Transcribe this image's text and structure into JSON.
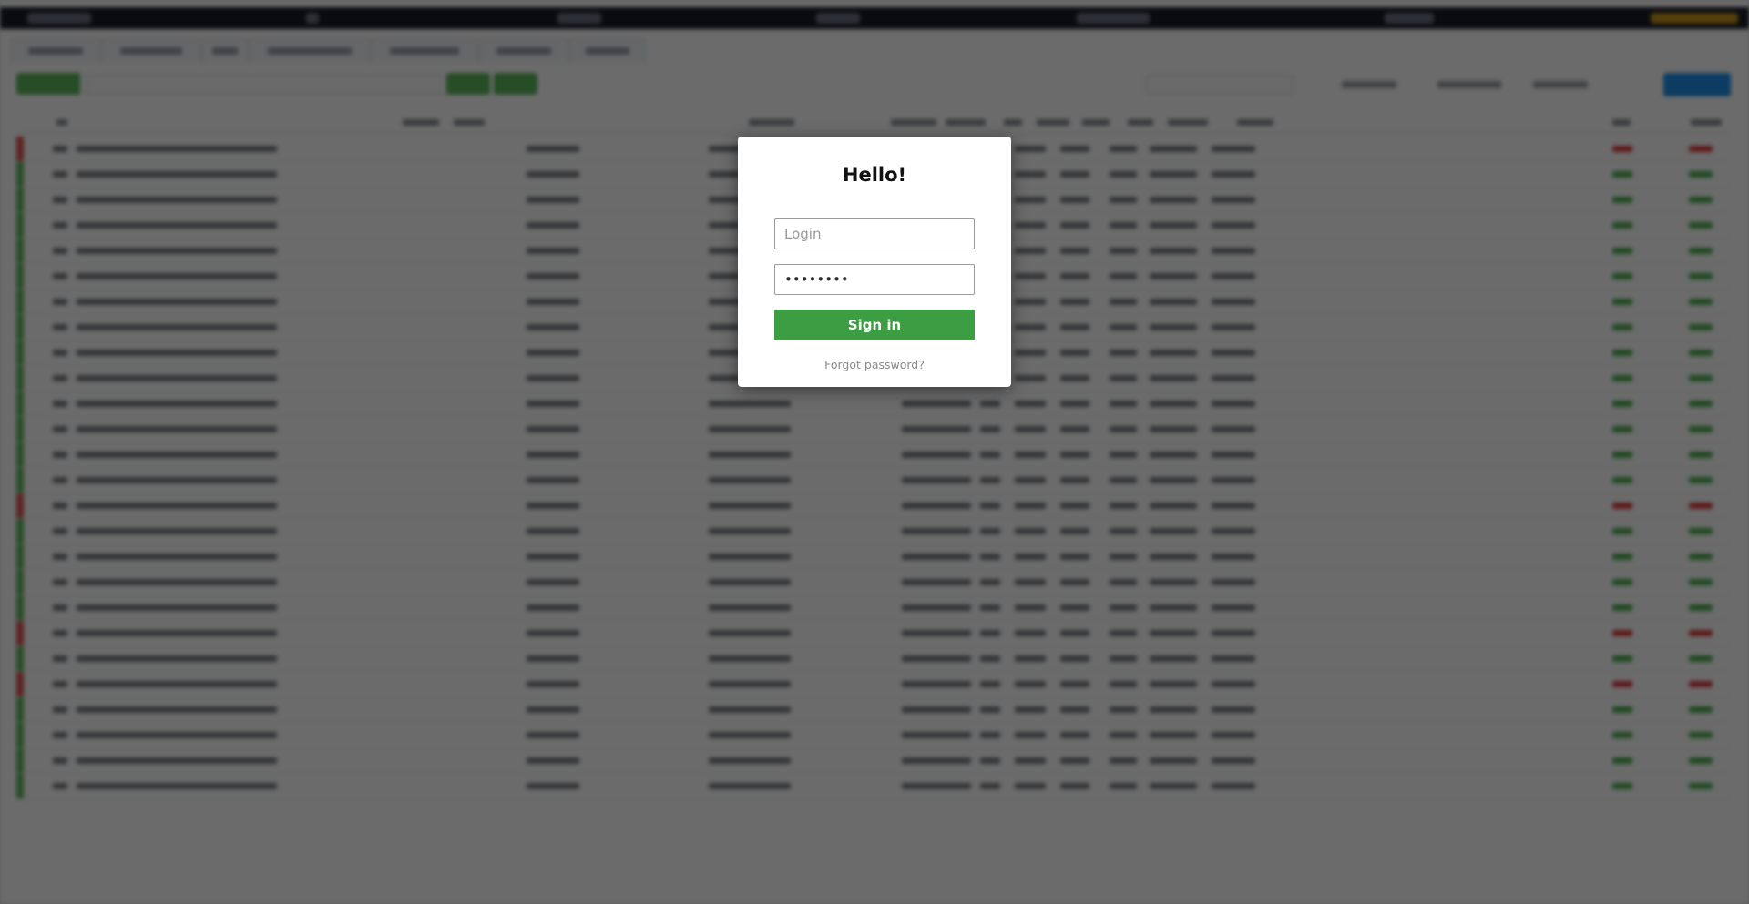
{
  "login_dialog": {
    "title": "Hello!",
    "login_placeholder": "Login",
    "password_value": "••••••••",
    "sign_in_label": "Sign in",
    "forgot_password_label": "Forgot password?"
  },
  "colors": {
    "sign_in_button": "#3d9d42",
    "overlay": "rgba(0,0,0,0.58)",
    "topbar": "#161b28",
    "accent_blue": "#1e90e6",
    "positive": "#4caf50",
    "negative": "#e03c3c"
  },
  "background_rows": [
    {
      "status": "negative"
    },
    {
      "status": "positive"
    },
    {
      "status": "positive"
    },
    {
      "status": "positive"
    },
    {
      "status": "positive"
    },
    {
      "status": "positive"
    },
    {
      "status": "positive"
    },
    {
      "status": "positive"
    },
    {
      "status": "positive"
    },
    {
      "status": "positive"
    },
    {
      "status": "positive"
    },
    {
      "status": "positive"
    },
    {
      "status": "positive"
    },
    {
      "status": "positive"
    },
    {
      "status": "negative"
    },
    {
      "status": "positive"
    },
    {
      "status": "positive"
    },
    {
      "status": "positive"
    },
    {
      "status": "positive"
    },
    {
      "status": "negative"
    },
    {
      "status": "positive"
    },
    {
      "status": "negative"
    },
    {
      "status": "positive"
    },
    {
      "status": "positive"
    },
    {
      "status": "positive"
    },
    {
      "status": "positive"
    }
  ]
}
